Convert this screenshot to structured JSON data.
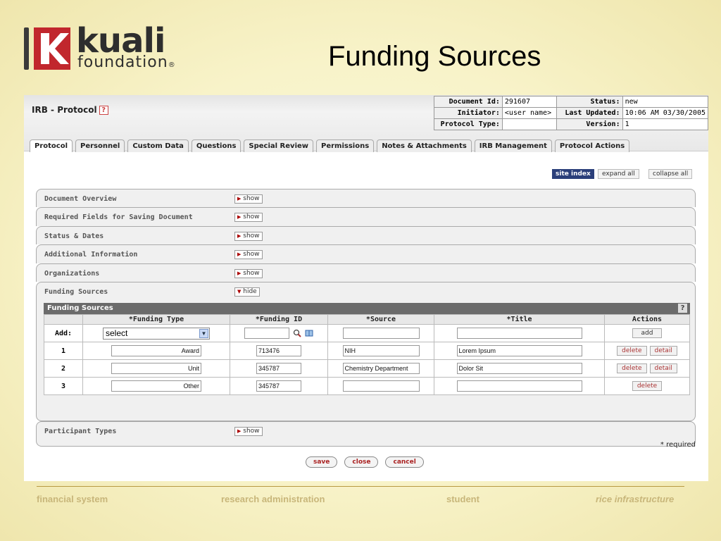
{
  "slide": {
    "logo": {
      "word1": "kuali",
      "word2": "foundation",
      "reg": "®"
    },
    "title": "Funding Sources"
  },
  "app": {
    "doc_title": "IRB - Protocol",
    "help": "?",
    "docinfo": {
      "doc_id_label": "Document Id:",
      "doc_id": "291607",
      "status_label": "Status:",
      "status": "new",
      "initiator_label": "Initiator:",
      "initiator": "<user name>",
      "last_updated_label": "Last Updated:",
      "last_updated": "10:06 AM 03/30/2005",
      "protocol_type_label": "Protocol Type:",
      "protocol_type": "",
      "version_label": "Version:",
      "version": "1"
    },
    "tabs": [
      "Protocol",
      "Personnel",
      "Custom Data",
      "Questions",
      "Special Review",
      "Permissions",
      "Notes & Attachments",
      "IRB Management",
      "Protocol Actions"
    ],
    "site_index": "site index",
    "expand_all": "expand all",
    "collapse_all": "collapse all",
    "panels": [
      {
        "label": "Document Overview",
        "toggle": "show"
      },
      {
        "label": "Required Fields for Saving Document",
        "toggle": "show"
      },
      {
        "label": "Status & Dates",
        "toggle": "show"
      },
      {
        "label": "Additional Information",
        "toggle": "show"
      },
      {
        "label": "Organizations",
        "toggle": "show"
      },
      {
        "label": "Funding Sources",
        "toggle": "hide"
      }
    ],
    "last_panel": {
      "label": "Participant Types",
      "toggle": "show"
    },
    "funding": {
      "title": "Funding Sources",
      "columns": [
        "",
        "*Funding Type",
        "*Funding ID",
        "*Source",
        "*Title",
        "Actions"
      ],
      "add_label": "Add:",
      "add_select": "select",
      "add_button": "add",
      "rows": [
        {
          "num": "1",
          "type": "Award",
          "id": "713476",
          "source": "NIH",
          "title": "Lorem Ipsum",
          "actions": [
            "delete",
            "detail"
          ]
        },
        {
          "num": "2",
          "type": "Unit",
          "id": "345787",
          "source": "Chemistry Department",
          "title": "Dolor Sit",
          "actions": [
            "delete",
            "detail"
          ]
        },
        {
          "num": "3",
          "type": "Other",
          "id": "345787",
          "source": "",
          "title": "",
          "actions": [
            "delete"
          ]
        }
      ]
    },
    "required_note": "* required",
    "buttons": {
      "save": "save",
      "close": "close",
      "cancel": "cancel"
    }
  },
  "footer": [
    "financial system",
    "research administration",
    "student",
    "rice infrastructure"
  ],
  "colors": {
    "accent_dark_blue": "#2b3f7a",
    "logo_red": "#c1272d",
    "footer_gold": "#c8b67a"
  }
}
